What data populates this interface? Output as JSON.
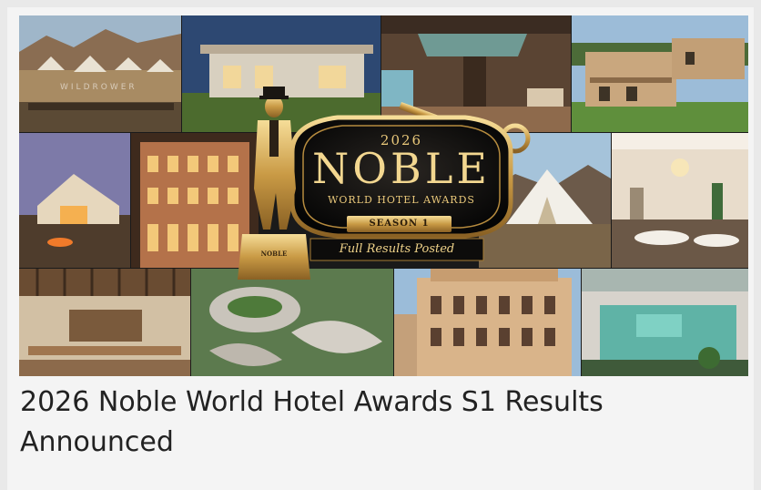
{
  "article": {
    "banner": {
      "logo_text": {
        "year": "2026",
        "name": "NOBLE",
        "subtitle": "WORLD HOTEL AWARDS",
        "season": "SEASON 1",
        "tagline": "Full Results Posted",
        "statue_base": "NOBLE"
      },
      "watermark": "WILDROWER"
    },
    "title": "2026 Noble World Hotel Awards S1 Results Announced"
  }
}
